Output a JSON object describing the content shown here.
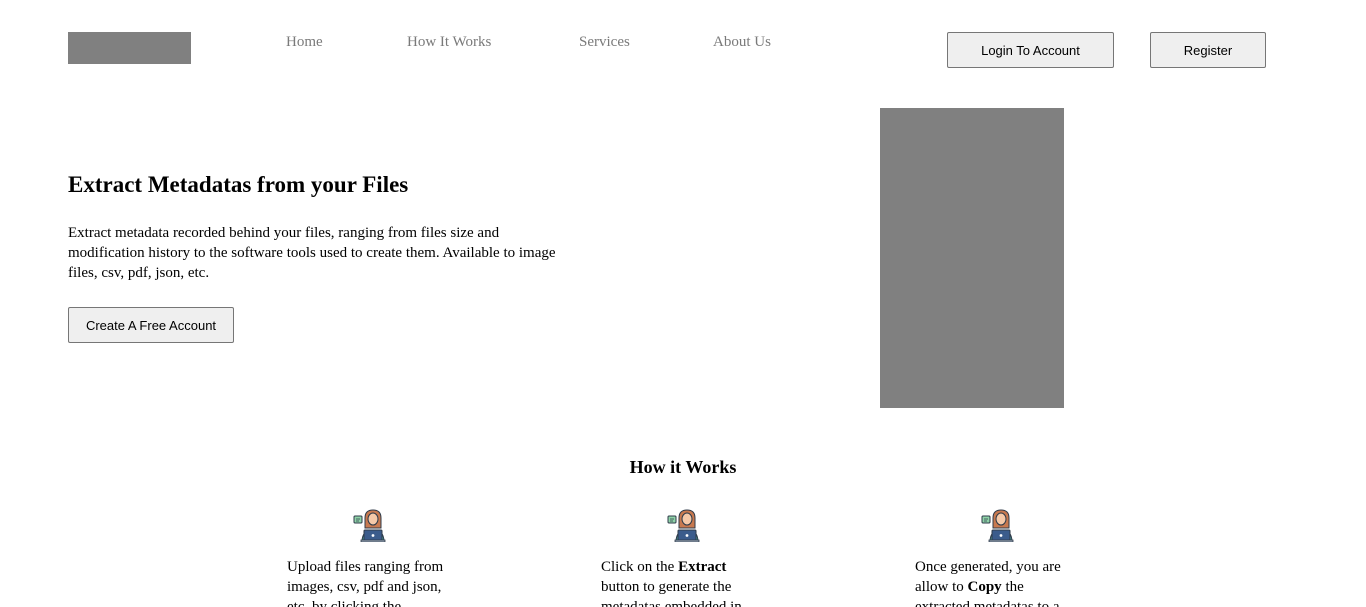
{
  "header": {
    "nav": {
      "home": "Home",
      "how_it_works": "How It Works",
      "services": "Services",
      "about_us": "About Us"
    },
    "login_label": "Login To Account",
    "register_label": "Register"
  },
  "hero": {
    "title": "Extract Metadatas from your Files",
    "description": "Extract metadata recorded behind your files, ranging from files size and modification history to the software tools used to create them. Available to image files, csv, pdf, json, etc.",
    "cta_label": "Create A Free Account"
  },
  "how_it_works": {
    "title": "How it Works",
    "steps": [
      {
        "icon": "person-laptop-icon",
        "text_before": "Upload files ranging from images, csv, pdf and json, etc. by clicking the",
        "bold": "",
        "text_after": ""
      },
      {
        "icon": "person-laptop-icon",
        "text_before": "Click on the ",
        "bold": "Extract",
        "text_after": " button to generate the metadatas embedded in"
      },
      {
        "icon": "person-laptop-icon",
        "text_before": "Once generated, you are allow to ",
        "bold": "Copy",
        "text_after": " the extracted metadatas to a"
      }
    ]
  },
  "colors": {
    "placeholder_gray": "#808080",
    "nav_text": "#7a7a7a",
    "button_bg": "#efefef",
    "button_border": "#767676"
  }
}
